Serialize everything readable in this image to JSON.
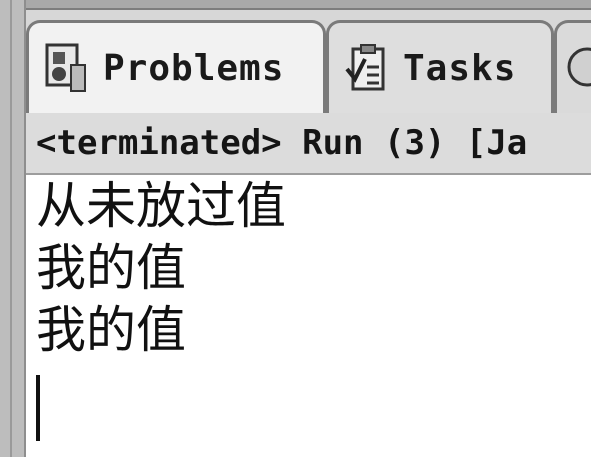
{
  "tabs": [
    {
      "label": "Problems",
      "icon": "problems-icon",
      "active": true
    },
    {
      "label": "Tasks",
      "icon": "tasks-icon",
      "active": false
    },
    {
      "label": "",
      "icon": "console-icon",
      "active": false
    }
  ],
  "status": {
    "text": "<terminated> Run (3) [Ja"
  },
  "console": {
    "lines": [
      "从未放过值",
      "我的值",
      "我的值"
    ]
  },
  "colors": {
    "console_bg": "#ffffff",
    "chrome_bg": "#d7d7d7",
    "tab_border": "#7a7a7a"
  }
}
